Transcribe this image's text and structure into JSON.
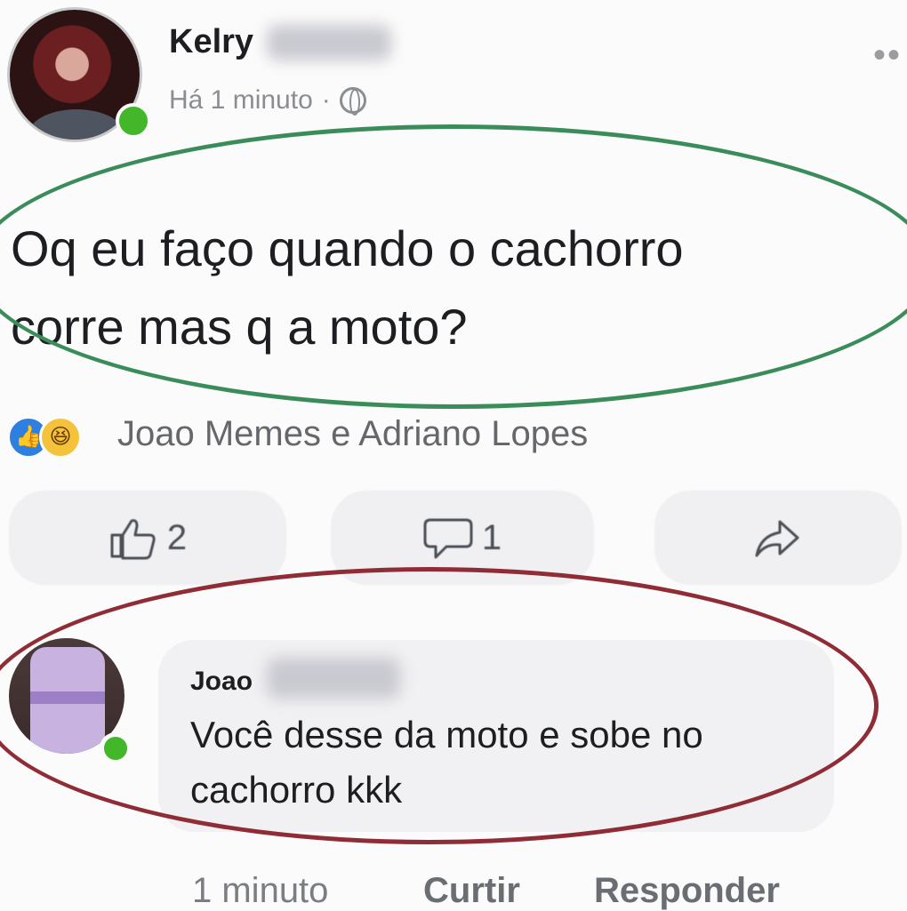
{
  "post": {
    "author_name": "Kelry",
    "timestamp": "Há 1 minuto",
    "separator": "·",
    "text_line1": "Oq eu faço quando o cachorro",
    "text_line2": "corre mas q a moto?",
    "reactors": "Joao Memes e Adriano Lopes",
    "like_count": "2",
    "comment_count": "1"
  },
  "comment": {
    "author_name": "Joao",
    "text": "Você desse da moto e sobe no cachorro kkk",
    "time": "1 minuto",
    "like_label": "Curtir",
    "reply_label": "Responder"
  },
  "icons": {
    "like": "thumbs-up-icon",
    "comment": "speech-bubble-icon",
    "share": "share-arrow-icon",
    "privacy": "globe-icon",
    "more": "more-options-icon"
  },
  "colors": {
    "online": "#42b72a",
    "like_reaction": "#2d7fe0",
    "haha_reaction": "#f5c33b",
    "highlight_post": "#3a8d5a",
    "highlight_comment": "#8f2c36"
  }
}
